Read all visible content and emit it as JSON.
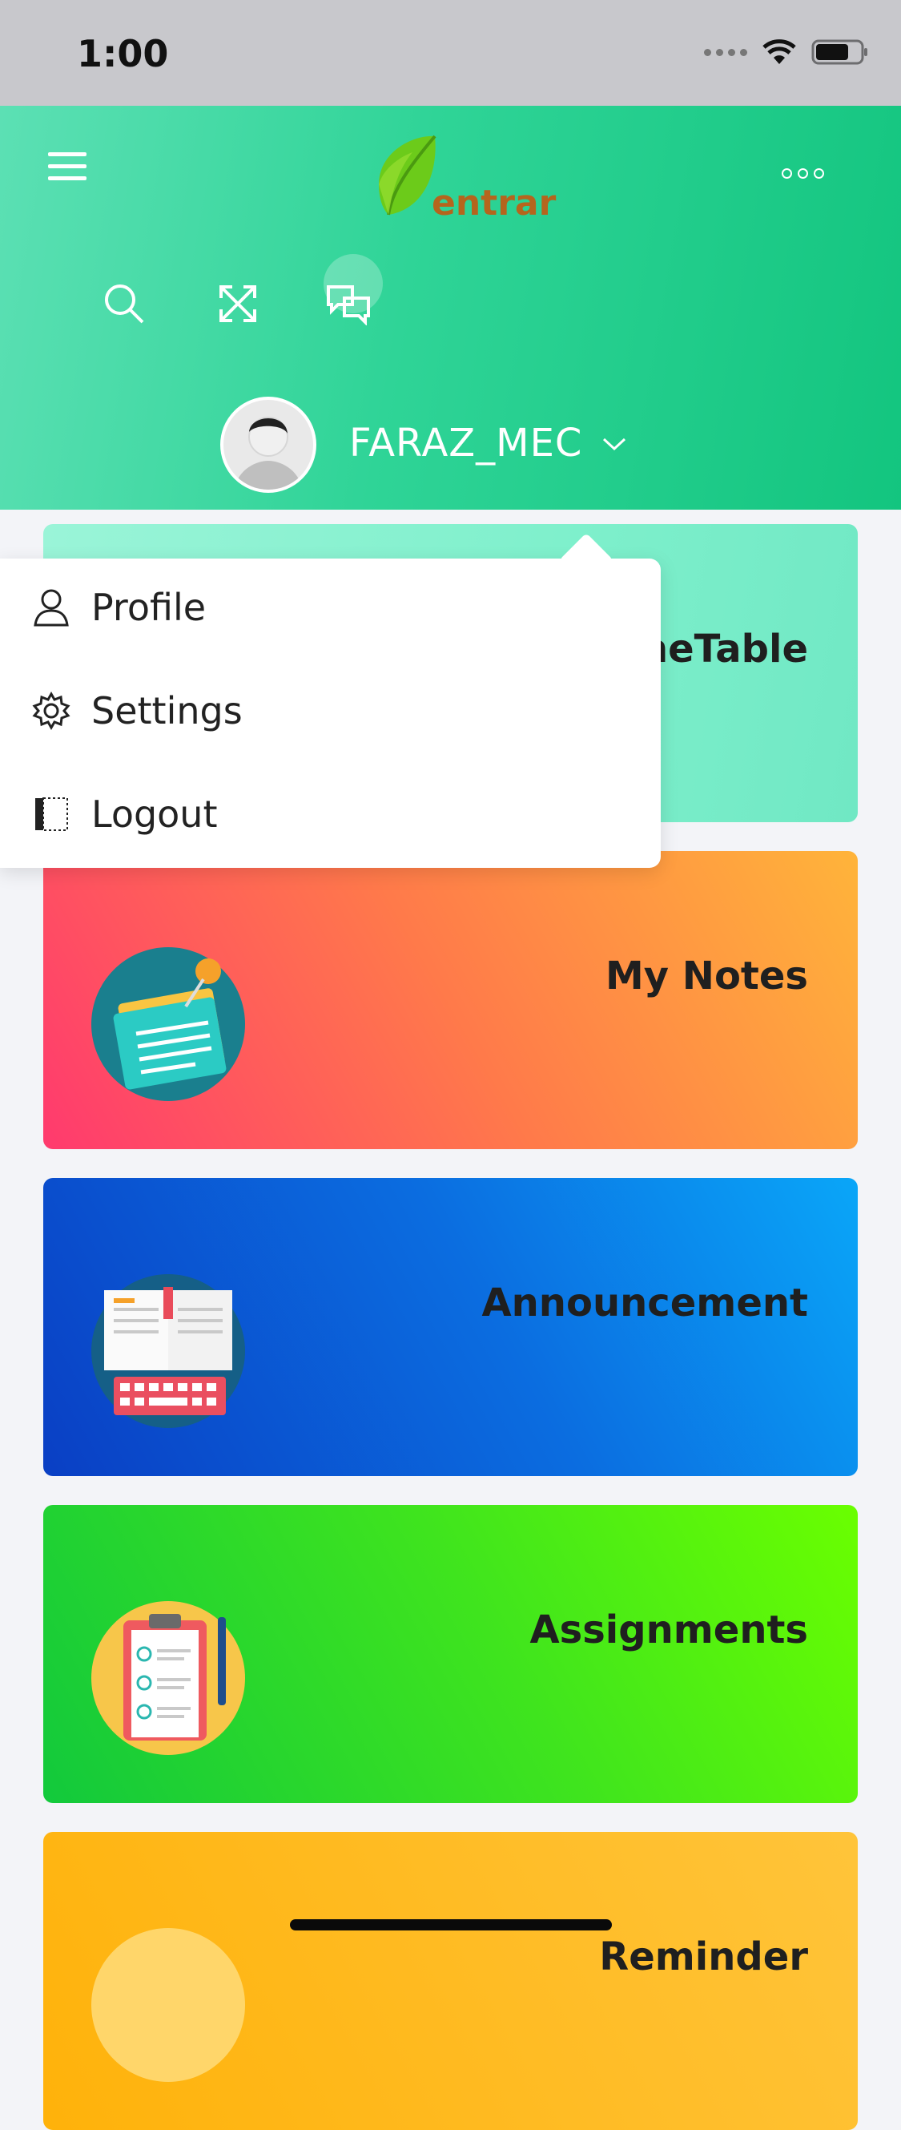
{
  "status": {
    "time": "1:00"
  },
  "header": {
    "logo_text": "entrar",
    "username": "FARAZ_MEC"
  },
  "dropdown": {
    "items": [
      {
        "label": "Profile",
        "icon": "person-icon"
      },
      {
        "label": "Settings",
        "icon": "gear-icon"
      },
      {
        "label": "Logout",
        "icon": "logout-icon"
      }
    ]
  },
  "cards": {
    "timetable": {
      "label": "neTable"
    },
    "notes": {
      "label": "My Notes"
    },
    "announcement": {
      "label": "Announcement"
    },
    "assignments": {
      "label": "Assignments"
    },
    "reminder": {
      "label": "Reminder"
    }
  },
  "colors": {
    "header_accent": "#2fd497",
    "notes_gradient": [
      "#ff3a6e",
      "#ffb43a"
    ],
    "announcement_gradient": [
      "#0a3fc4",
      "#0aa6f8"
    ],
    "assignments_gradient": [
      "#12c93c",
      "#6aff00"
    ]
  }
}
